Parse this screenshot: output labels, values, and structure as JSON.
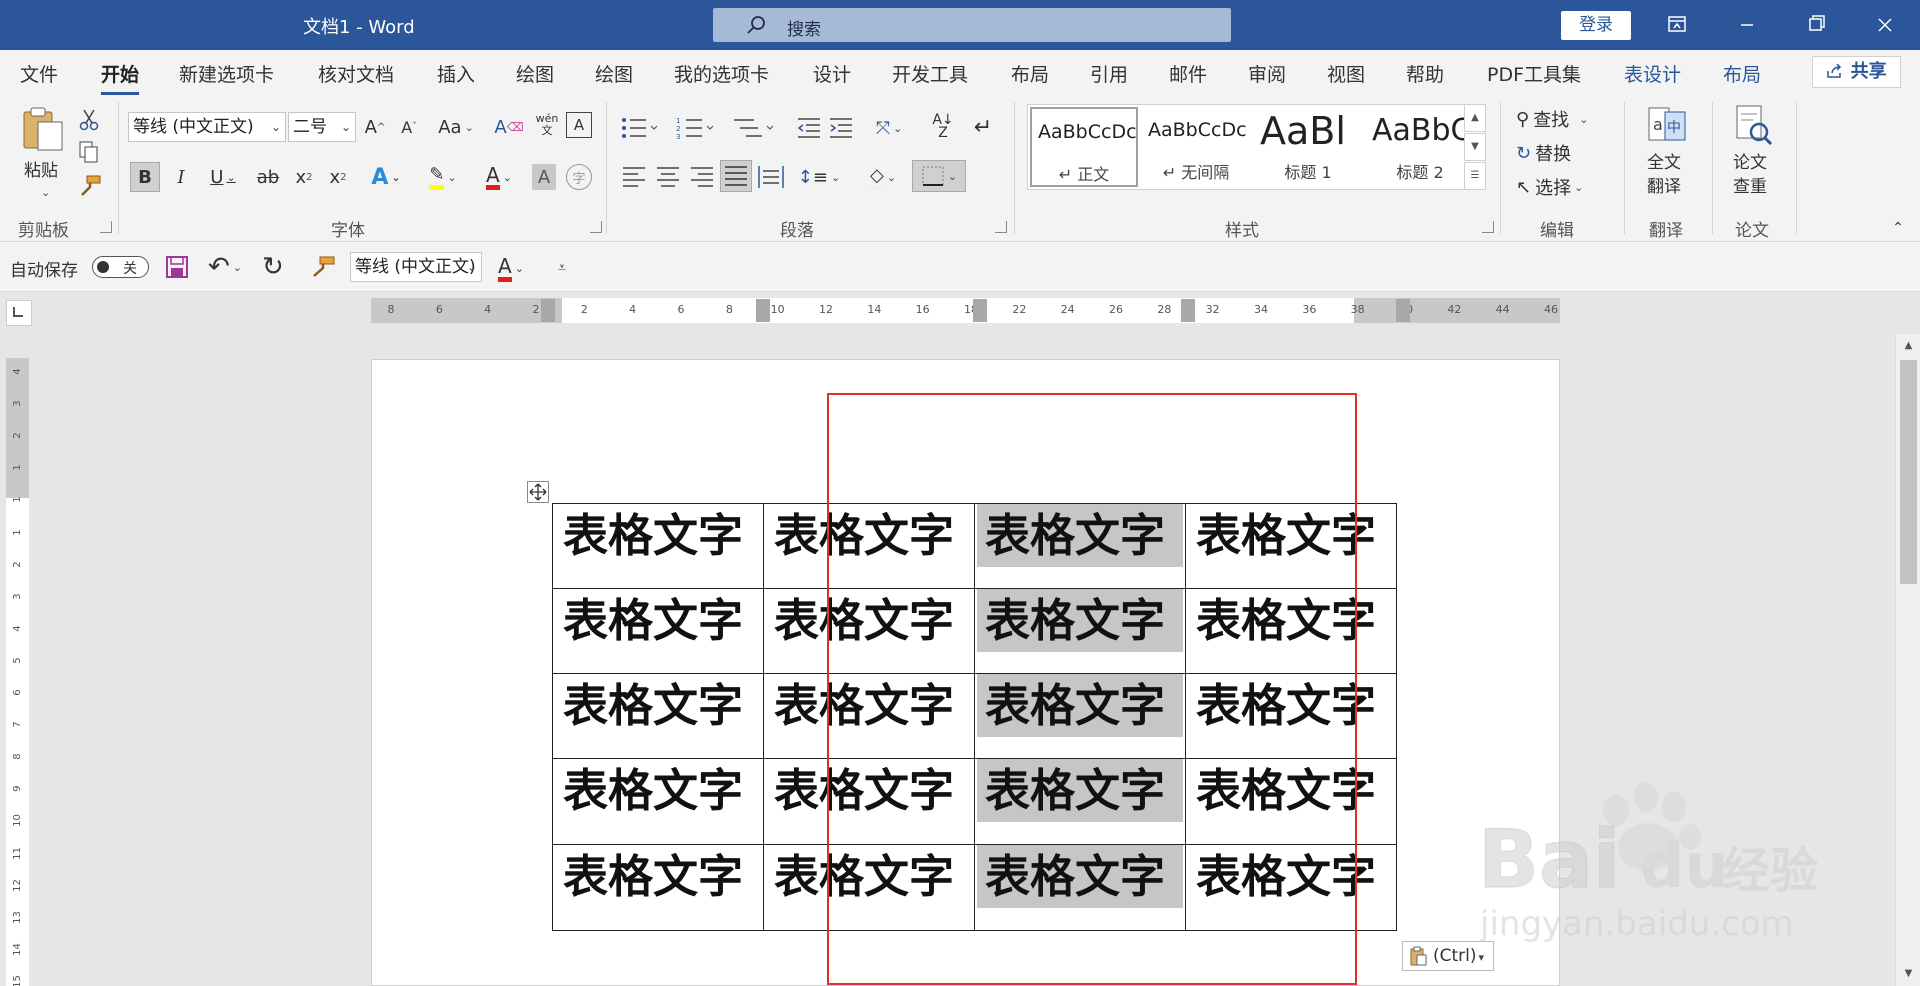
{
  "app": {
    "title": "文档1  -  Word",
    "search_placeholder": "搜索",
    "login_label": "登录"
  },
  "tabs": [
    {
      "label": "文件"
    },
    {
      "label": "开始",
      "active": true
    },
    {
      "label": "新建选项卡"
    },
    {
      "label": "核对文档"
    },
    {
      "label": "插入"
    },
    {
      "label": "绘图"
    },
    {
      "label": "绘图"
    },
    {
      "label": "我的选项卡"
    },
    {
      "label": "设计"
    },
    {
      "label": "开发工具"
    },
    {
      "label": "布局"
    },
    {
      "label": "引用"
    },
    {
      "label": "邮件"
    },
    {
      "label": "审阅"
    },
    {
      "label": "视图"
    },
    {
      "label": "帮助"
    },
    {
      "label": "PDF工具集"
    },
    {
      "label": "表设计",
      "context": true
    },
    {
      "label": "布局",
      "context": true
    }
  ],
  "share_label": "共享",
  "ribbon": {
    "clipboard": {
      "paste_label": "粘贴",
      "group_label": "剪贴板"
    },
    "font": {
      "font_name": "等线 (中文正文)",
      "font_size": "二号",
      "change_case": "Aa",
      "phonetic": "wén",
      "group_label": "字体"
    },
    "paragraph": {
      "group_label": "段落"
    },
    "styles": {
      "items": [
        {
          "sample": "AaBbCcDc",
          "name": "↵ 正文",
          "selected": true
        },
        {
          "sample": "AaBbCcDc",
          "name": "↵ 无间隔"
        },
        {
          "sample": "AaBl",
          "name": "标题 1"
        },
        {
          "sample": "AaBbC",
          "name": "标题 2"
        }
      ],
      "group_label": "样式"
    },
    "editing": {
      "find": "查找",
      "replace": "替换",
      "select": "选择",
      "group_label": "编辑"
    },
    "translate": {
      "button_label": "全文\n翻译",
      "line1": "全文",
      "line2": "翻译",
      "group_label": "翻译"
    },
    "paper": {
      "line1": "论文",
      "line2": "查重",
      "group_label": "论文"
    }
  },
  "qat": {
    "autosave_label": "自动保存",
    "autosave_state": "关",
    "font_combo": "等线 (中文正文)"
  },
  "ruler": {
    "ticks": [
      "8",
      "6",
      "4",
      "2",
      "2",
      "4",
      "6",
      "8",
      "10",
      "12",
      "14",
      "16",
      "18",
      "22",
      "24",
      "26",
      "28",
      "32",
      "34",
      "36",
      "38",
      "40",
      "42",
      "44",
      "46"
    ],
    "vticks": [
      "4",
      "3",
      "2",
      "1",
      "1",
      "1",
      "2",
      "3",
      "4",
      "5",
      "6",
      "7",
      "8",
      "9",
      "10",
      "11",
      "12",
      "13",
      "14",
      "15"
    ]
  },
  "table": {
    "rows": [
      [
        "表格文字",
        "表格文字",
        "表格文字",
        "表格文字"
      ],
      [
        "表格文字",
        "表格文字",
        "表格文字",
        "表格文字"
      ],
      [
        "表格文字",
        "表格文字",
        "表格文字",
        "表格文字"
      ],
      [
        "表格文字",
        "表格文字",
        "表格文字",
        "表格文字"
      ],
      [
        "表格文字",
        "表格文字",
        "表格文字",
        "表格文字"
      ]
    ],
    "selected_column": 2
  },
  "paste_options_label": "(Ctrl)",
  "watermark": {
    "brand": "Bai du 经验",
    "url": "jingyan.baidu.com"
  },
  "colors": {
    "title_bar": "#2b579a",
    "highlight_box": "#e0302a",
    "selection": "#c6c6c6",
    "font_color_red": "#e02020",
    "highlight_yellow": "#ffff00"
  },
  "icons": [
    "search-icon",
    "ribbon-display-icon",
    "minimize-icon",
    "restore-icon",
    "close-icon",
    "share-icon",
    "paste-icon",
    "cut-icon",
    "copy-icon",
    "format-painter-icon",
    "grow-font-icon",
    "shrink-font-icon",
    "clear-format-icon",
    "char-border-icon",
    "bold-icon",
    "italic-icon",
    "underline-icon",
    "strikethrough-icon",
    "subscript-icon",
    "superscript-icon",
    "text-effects-icon",
    "highlighter-icon",
    "font-color-icon",
    "char-shading-icon",
    "enclose-char-icon",
    "bullets-icon",
    "numbering-icon",
    "multilevel-list-icon",
    "decrease-indent-icon",
    "increase-indent-icon",
    "chinese-layout-icon",
    "sort-icon",
    "show-marks-icon",
    "align-left-icon",
    "center-icon",
    "align-right-icon",
    "justify-icon",
    "distributed-icon",
    "line-spacing-icon",
    "shading-icon",
    "borders-icon",
    "find-icon",
    "replace-icon",
    "select-icon",
    "translate-icon",
    "plagiarism-check-icon",
    "save-icon",
    "undo-icon",
    "redo-icon",
    "table-move-icon",
    "clipboard-icon"
  ]
}
